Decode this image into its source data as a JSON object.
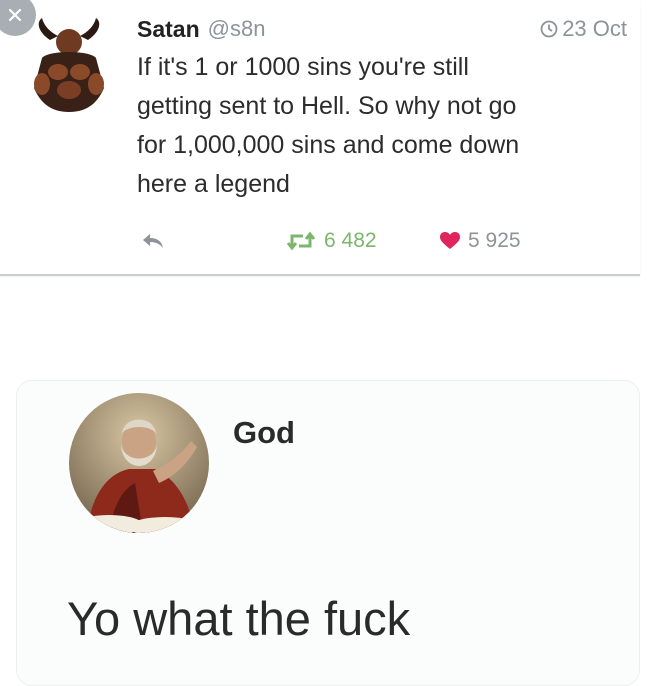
{
  "tweet": {
    "author_name": "Satan",
    "author_handle": "@s8n",
    "date": "23 Oct",
    "text": "If it's 1 or 1000 sins you're still\ngetting sent to Hell. So why not go\nfor 1,000,000 sins and come down\nhere a legend",
    "retweet_count": "6 482",
    "like_count": "5 925"
  },
  "reply": {
    "author_name": "God",
    "text": "Yo what the fuck"
  },
  "colors": {
    "retweet_green": "#7cb56c",
    "like_red": "#e0245e",
    "meta_gray": "#8d9399"
  },
  "icons": {
    "close": "close-icon",
    "clock": "clock-icon",
    "reply": "reply-icon",
    "retweet": "retweet-icon",
    "like": "heart-icon"
  }
}
